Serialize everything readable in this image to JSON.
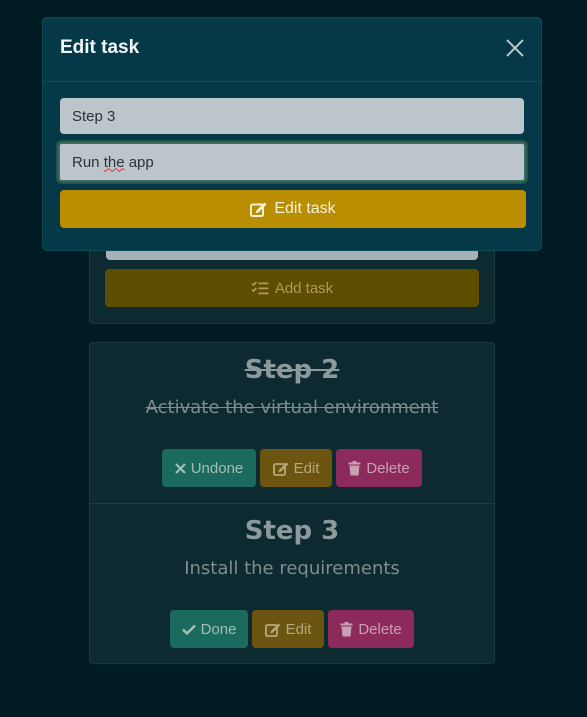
{
  "page": {
    "add_form": {
      "add_button_label": "Add task"
    },
    "tasks": [
      {
        "title": "Step 2",
        "description": "Activate the virtual environment",
        "completed": true,
        "toggle_label": "Undone",
        "edit_label": "Edit",
        "delete_label": "Delete"
      },
      {
        "title": "Step 3",
        "description": "Install the requirements",
        "completed": false,
        "toggle_label": "Done",
        "edit_label": "Edit",
        "delete_label": "Delete"
      }
    ]
  },
  "modal": {
    "title": "Edit task",
    "close_icon": "close-icon",
    "title_field_value": "Step 3",
    "description_field_value": "Run the app",
    "submit_label": "Edit task"
  },
  "colors": {
    "background": "#001b24",
    "modal": "#063947",
    "primary_gold": "#b98e00",
    "success": "#1b6a5e",
    "danger": "#8c2a5c"
  }
}
